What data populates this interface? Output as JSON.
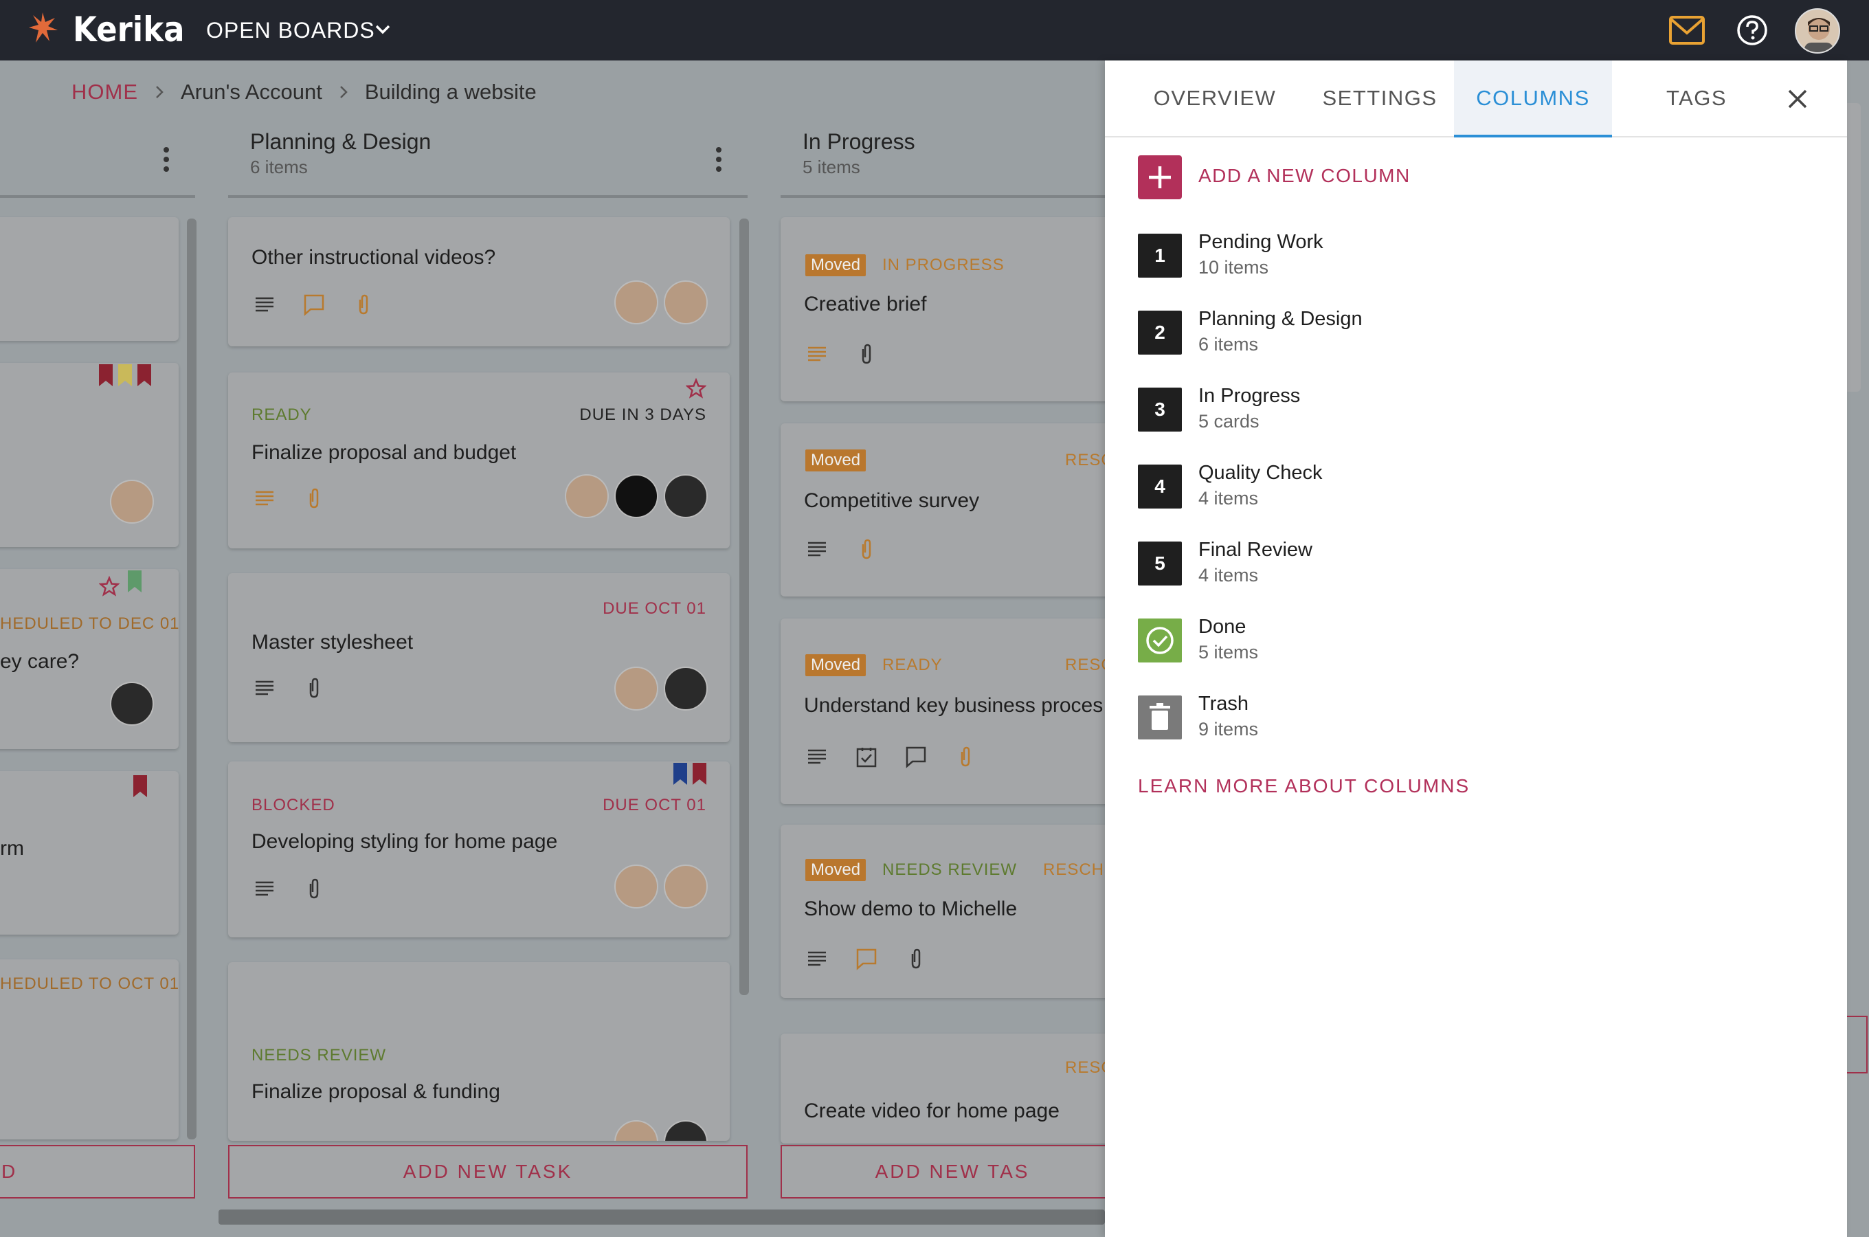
{
  "app": {
    "brand": "Kerika",
    "open_boards": "OPEN BOARDS"
  },
  "breadcrumb": {
    "home": "HOME",
    "account": "Arun's Account",
    "board": "Building a website"
  },
  "columns": [
    {
      "title": "Planning & Design",
      "count": "6 items",
      "add_label": "ADD NEW TASK",
      "cards": [
        {
          "title": "Other instructional videos?",
          "status": "",
          "due": ""
        },
        {
          "title": "Finalize proposal and budget",
          "status": "READY",
          "due": "DUE IN 3 DAYS"
        },
        {
          "title": "Master stylesheet",
          "status": "",
          "due": "DUE OCT 01"
        },
        {
          "title": "Developing styling for home page",
          "status": "BLOCKED",
          "due": "DUE OCT 01"
        },
        {
          "title": "Finalize proposal & funding",
          "status": "NEEDS REVIEW",
          "due": ""
        }
      ]
    },
    {
      "title": "In Progress",
      "count": "5 items",
      "add_label": "ADD NEW TAS",
      "cards": [
        {
          "moved": "Moved",
          "status": "IN PROGRESS",
          "title": "Creative brief",
          "right": ""
        },
        {
          "moved": "Moved",
          "status": "",
          "title": "Competitive survey",
          "right": "RESC"
        },
        {
          "moved": "Moved",
          "status": "READY",
          "title": "Understand key business proces",
          "right": "RESC"
        },
        {
          "moved": "Moved",
          "status": "NEEDS REVIEW",
          "title": "Show demo to Michelle",
          "right": "RESCHE"
        },
        {
          "moved": "",
          "status": "",
          "title": "Create video for home page",
          "right": "RESC"
        }
      ]
    }
  ],
  "partial_column": {
    "cards": [
      {
        "status": "HEDULED TO DEC 01",
        "title": "ey care?"
      },
      {
        "title": "rm"
      },
      {
        "status": "HEDULED TO OCT 01"
      }
    ],
    "add_label": "D"
  },
  "panel": {
    "tabs": [
      "OVERVIEW",
      "SETTINGS",
      "COLUMNS",
      "TAGS"
    ],
    "active_tab": "COLUMNS",
    "add_column": "ADD A NEW COLUMN",
    "columns": [
      {
        "num": "1",
        "name": "Pending Work",
        "count": "10 items"
      },
      {
        "num": "2",
        "name": "Planning & Design",
        "count": "6 items"
      },
      {
        "num": "3",
        "name": "In Progress",
        "count": "5 cards"
      },
      {
        "num": "4",
        "name": "Quality Check",
        "count": "4 items"
      },
      {
        "num": "5",
        "name": "Final Review",
        "count": "4 items"
      },
      {
        "num": "",
        "name": "Done",
        "count": "5 items"
      },
      {
        "num": "",
        "name": "Trash",
        "count": "9 items"
      }
    ],
    "learn_more": "LEARN MORE ABOUT COLUMNS"
  },
  "colors": {
    "accent": "#b2305a",
    "tab_active": "#2b8fd6",
    "topbar": "#23262e",
    "done_green": "#77ad48"
  },
  "icons": [
    "kerika-logo-icon",
    "chevron-down-icon",
    "mail-icon",
    "help-icon",
    "chevron-right-icon",
    "kebab-icon",
    "description-icon",
    "comment-icon",
    "attachment-icon",
    "checklist-icon",
    "star-icon",
    "flag-icon",
    "close-icon",
    "plus-icon",
    "check-circle-icon",
    "trash-icon"
  ]
}
